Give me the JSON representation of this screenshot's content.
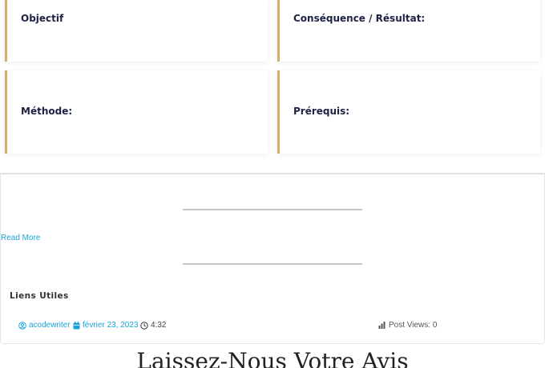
{
  "cards": {
    "objectif": "Objectif",
    "consequence": "Conséquence / Résultat:",
    "methode": "Méthode:",
    "prerequis": "Prérequis:"
  },
  "read_more": "Read More",
  "liens_title": "Liens Utiles",
  "meta": {
    "author": "acodewriter",
    "date": "février 23, 2023",
    "time": "4:32",
    "views": "Post Views: 0"
  },
  "review_heading": "Laissez-Nous Votre Avis",
  "colors": {
    "accent_border": "#d4b06a",
    "card_title": "#1e2245",
    "link": "#1aa3d9"
  },
  "icons": [
    "user-icon",
    "calendar-icon",
    "clock-icon",
    "bar-chart-icon"
  ]
}
